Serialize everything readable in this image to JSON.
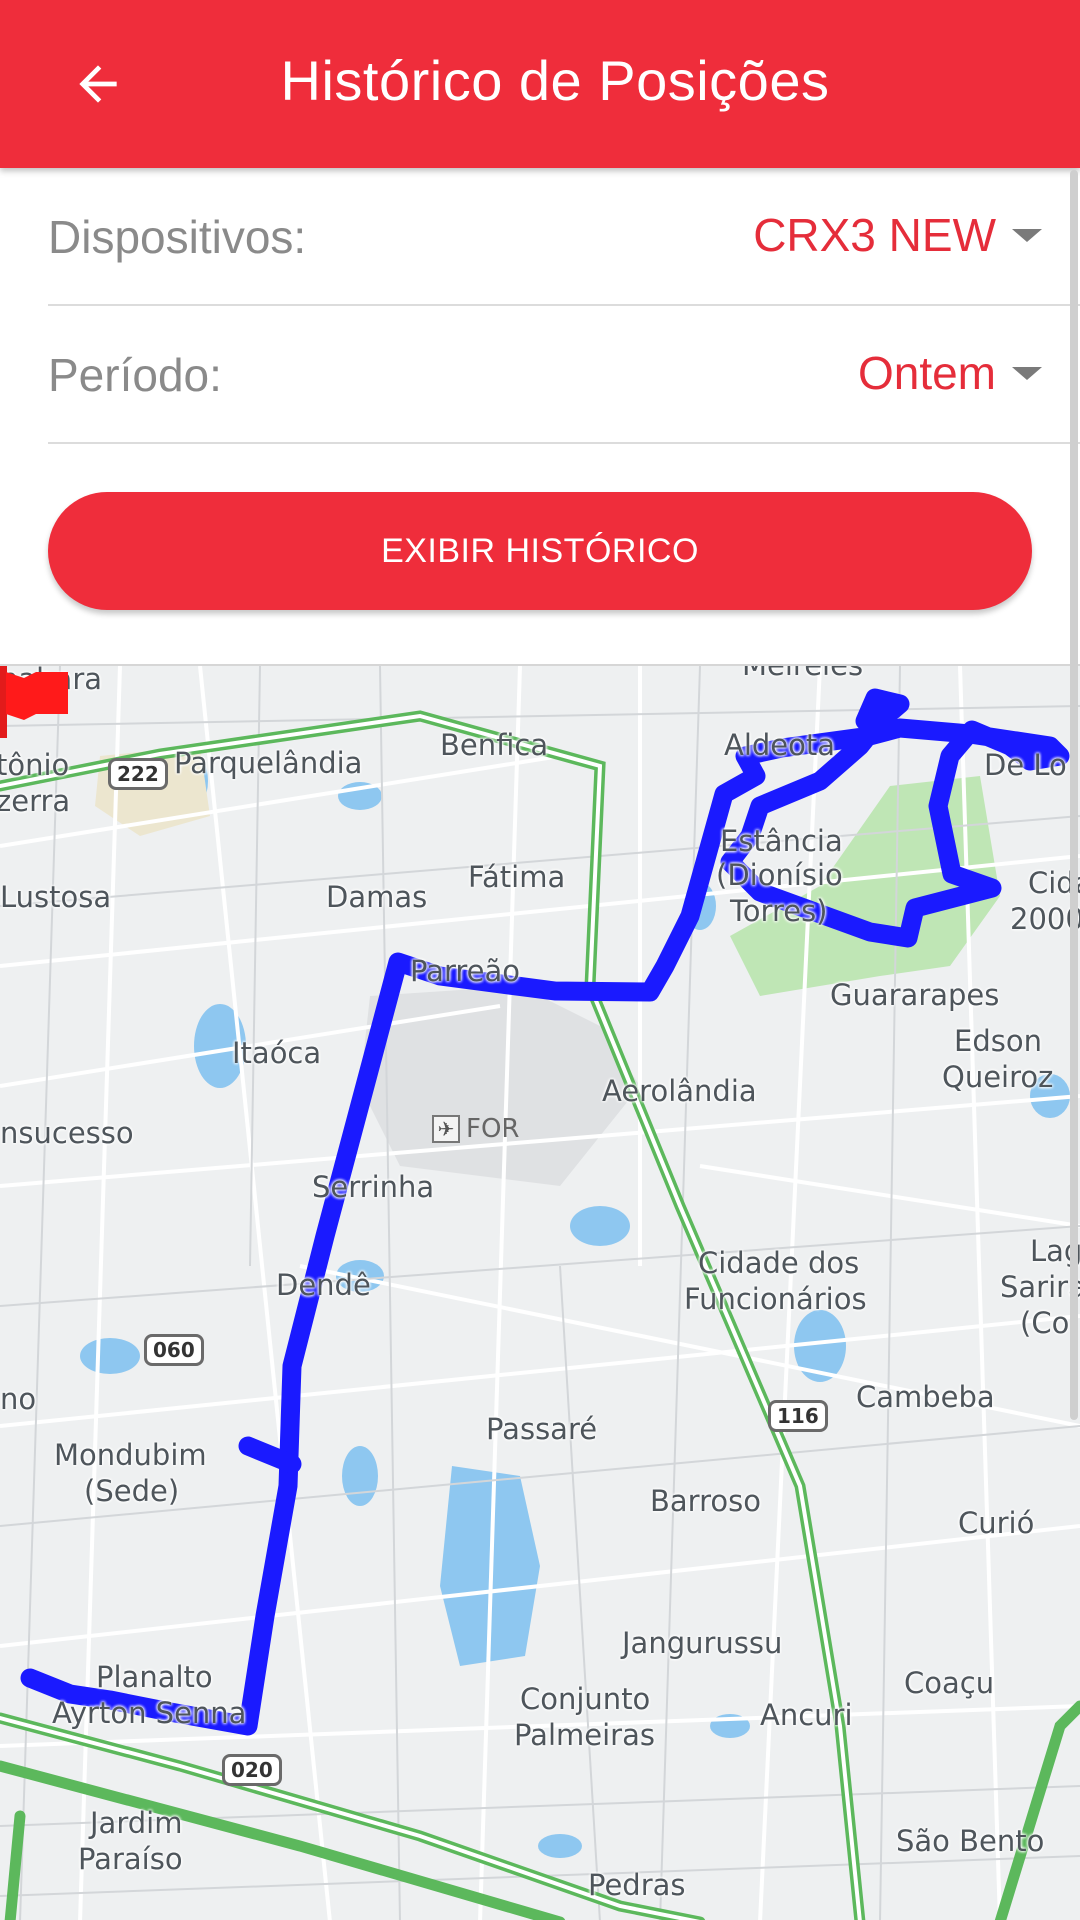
{
  "appbar": {
    "title": "Histórico de Posições",
    "back_icon": "arrow-left-icon",
    "color": "#ef2d3b"
  },
  "form": {
    "devices": {
      "label": "Dispositivos:",
      "value": "CRX3 NEW"
    },
    "period": {
      "label": "Período:",
      "value": "Ontem"
    },
    "submit_label": "EXIBIR HISTÓRICO"
  },
  "map": {
    "route_color": "#1a1aff",
    "flag_icon": "red-flag-icon",
    "airport": {
      "icon": "airport-icon",
      "label": "FOR"
    },
    "places": [
      "nabara",
      "tônio",
      "zerra",
      "Parquelândia",
      "Benfica",
      "Meireles",
      "Aldeota",
      "De Lo",
      "Lustosa",
      "Damas",
      "Fátima",
      "Estância",
      "(Dionísio",
      "Torres)",
      "Cida",
      "2000",
      "Parreão",
      "Guararapes",
      "Edson",
      "Queiroz",
      "Itaóca",
      "Aerolândia",
      "nsucesso",
      "Serrinha",
      "Dendê",
      "Cidade dos",
      "Funcionários",
      "Lag",
      "Sarira",
      "(Co",
      "no",
      "Mondubim",
      "(Sede)",
      "Passaré",
      "Cambeba",
      "Barroso",
      "Curió",
      "Planalto",
      "Ayrton Senna",
      "Jangurussu",
      "Conjunto",
      "Palmeiras",
      "Ancuri",
      "Coaçu",
      "Jardim",
      "Paraíso",
      "Pedras",
      "São Bento"
    ],
    "shields": [
      "222",
      "060",
      "116",
      "020"
    ]
  }
}
